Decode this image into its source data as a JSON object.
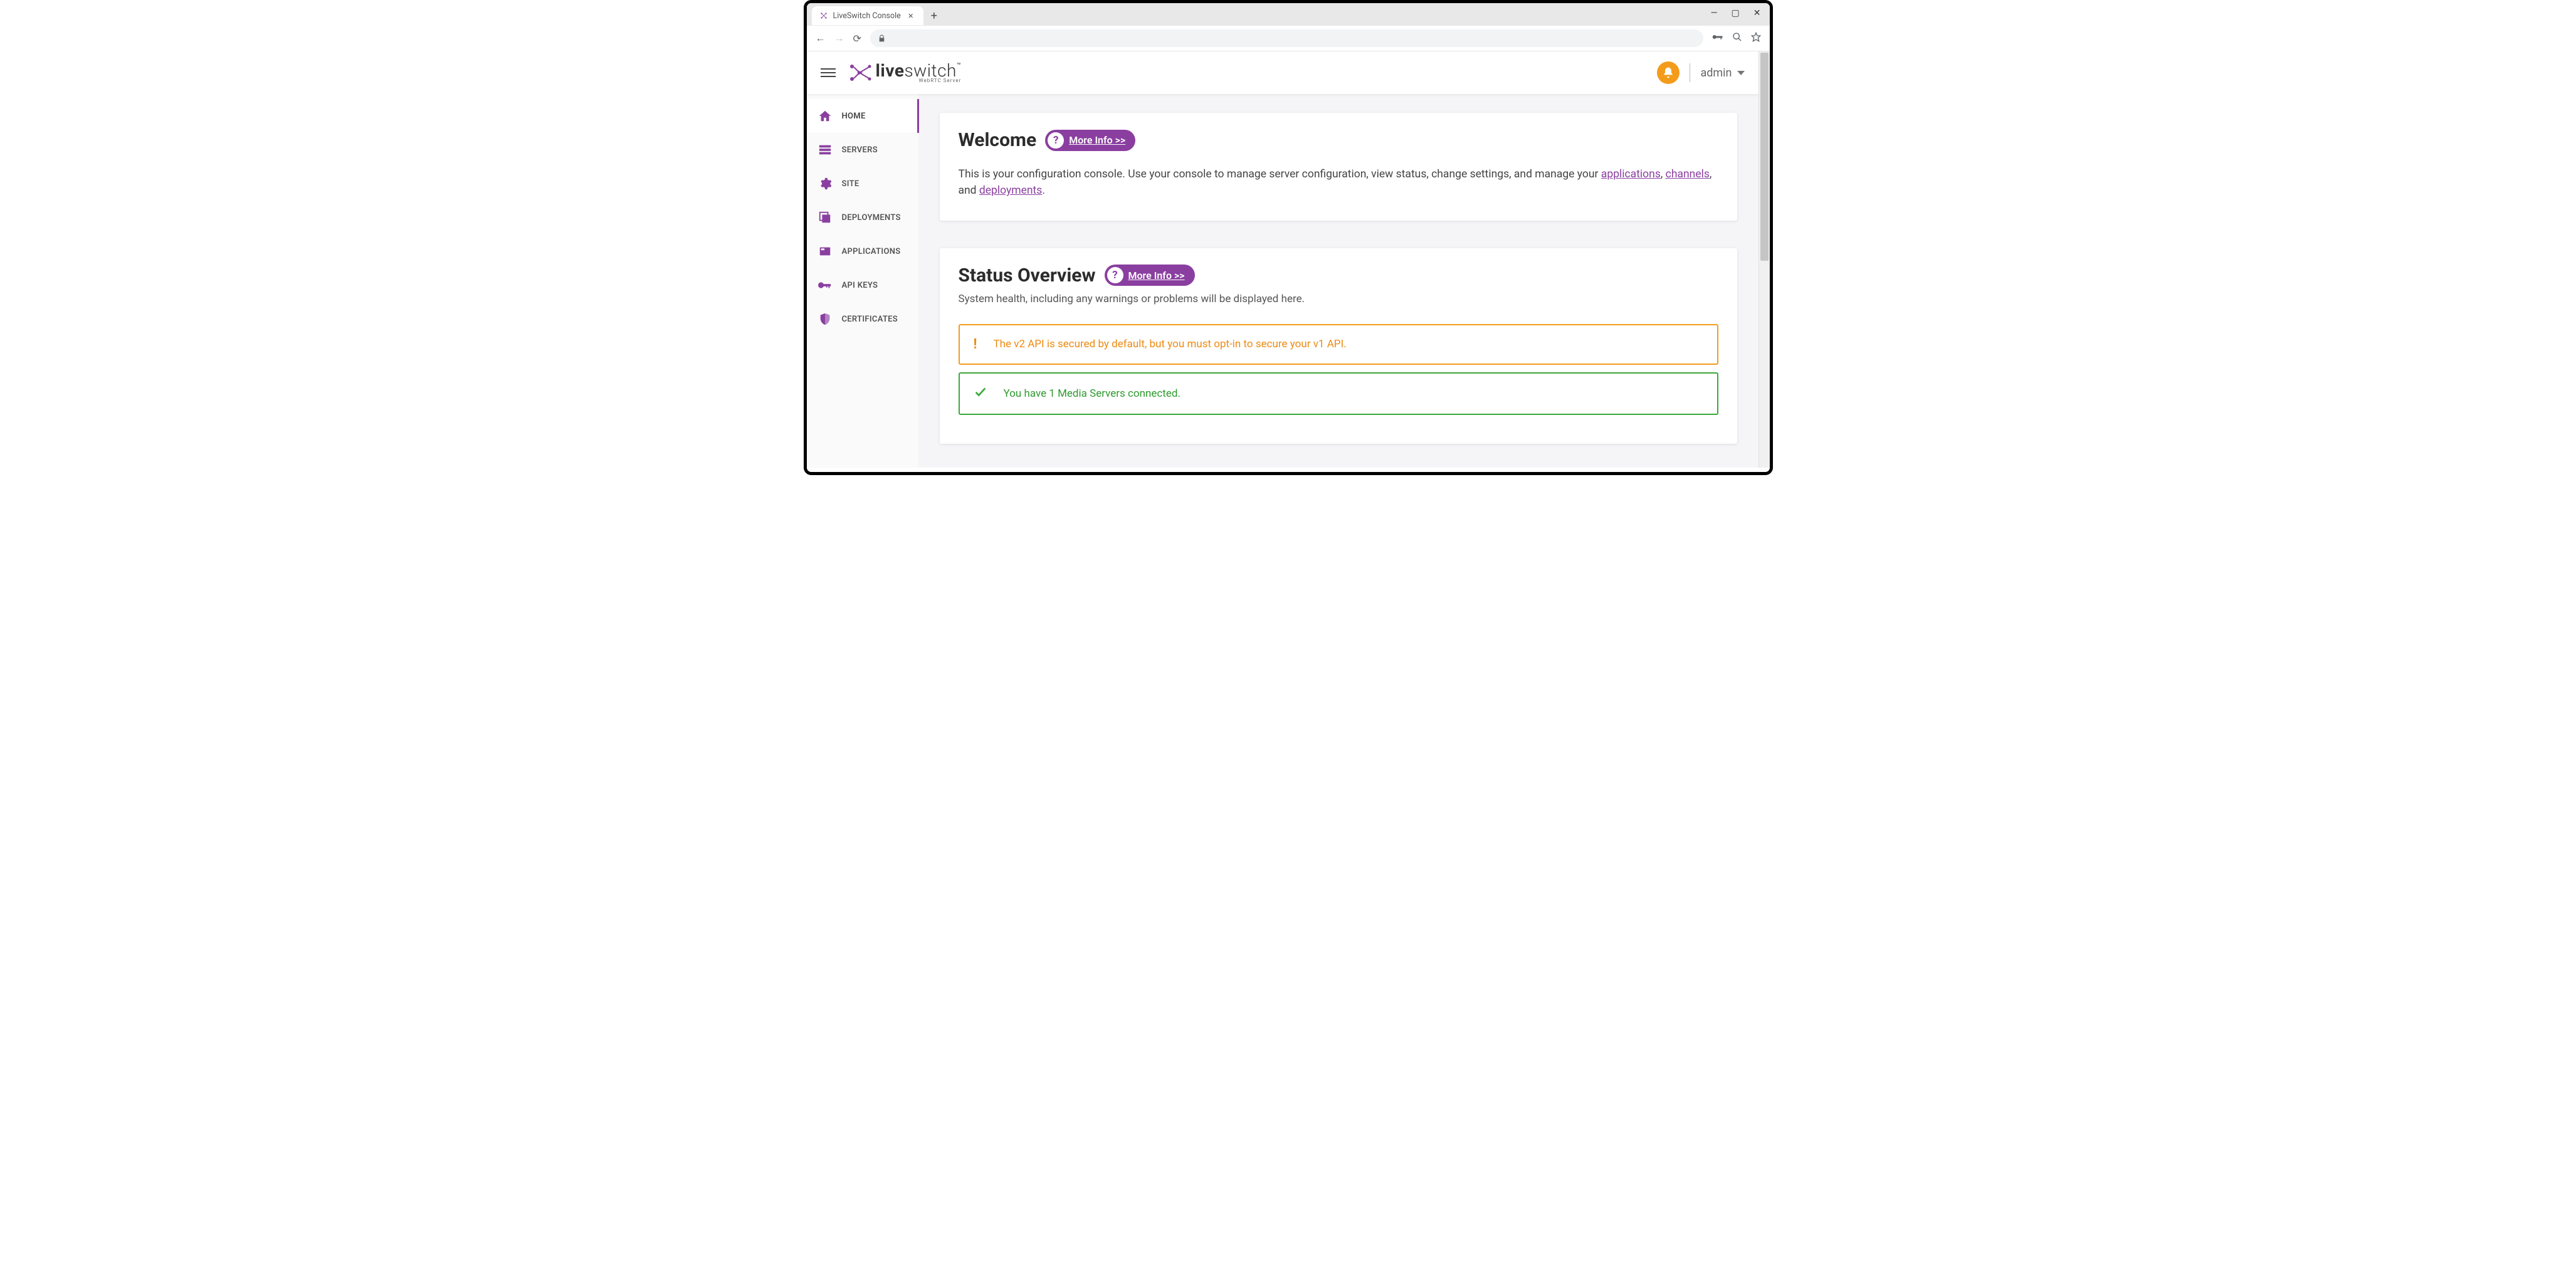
{
  "browser": {
    "tab_title": "LiveSwitch Console"
  },
  "header": {
    "product_bold": "live",
    "product_rest": "switch",
    "product_tagline": "WebRTC Server",
    "user_label": "admin"
  },
  "sidebar": {
    "items": [
      {
        "label": "HOME"
      },
      {
        "label": "SERVERS"
      },
      {
        "label": "SITE"
      },
      {
        "label": "DEPLOYMENTS"
      },
      {
        "label": "APPLICATIONS"
      },
      {
        "label": "API KEYS"
      },
      {
        "label": "CERTIFICATES"
      }
    ]
  },
  "welcome": {
    "title": "Welcome",
    "more_info": "More Info >>",
    "body_prefix": "This is your configuration console. Use your console to manage server configuration, view status, change settings, and manage your ",
    "link_apps": "applications",
    "sep1": ", ",
    "link_channels": "channels",
    "sep2": ", and ",
    "link_deployments": "deployments",
    "body_suffix": "."
  },
  "status": {
    "title": "Status Overview",
    "more_info": "More Info >>",
    "description": "System health, including any warnings or problems will be displayed here.",
    "alerts": [
      {
        "type": "warn",
        "text": "The v2 API is secured by default, but you must opt-in to secure your v1 API."
      },
      {
        "type": "ok",
        "text": "You have 1 Media Servers connected."
      }
    ]
  }
}
